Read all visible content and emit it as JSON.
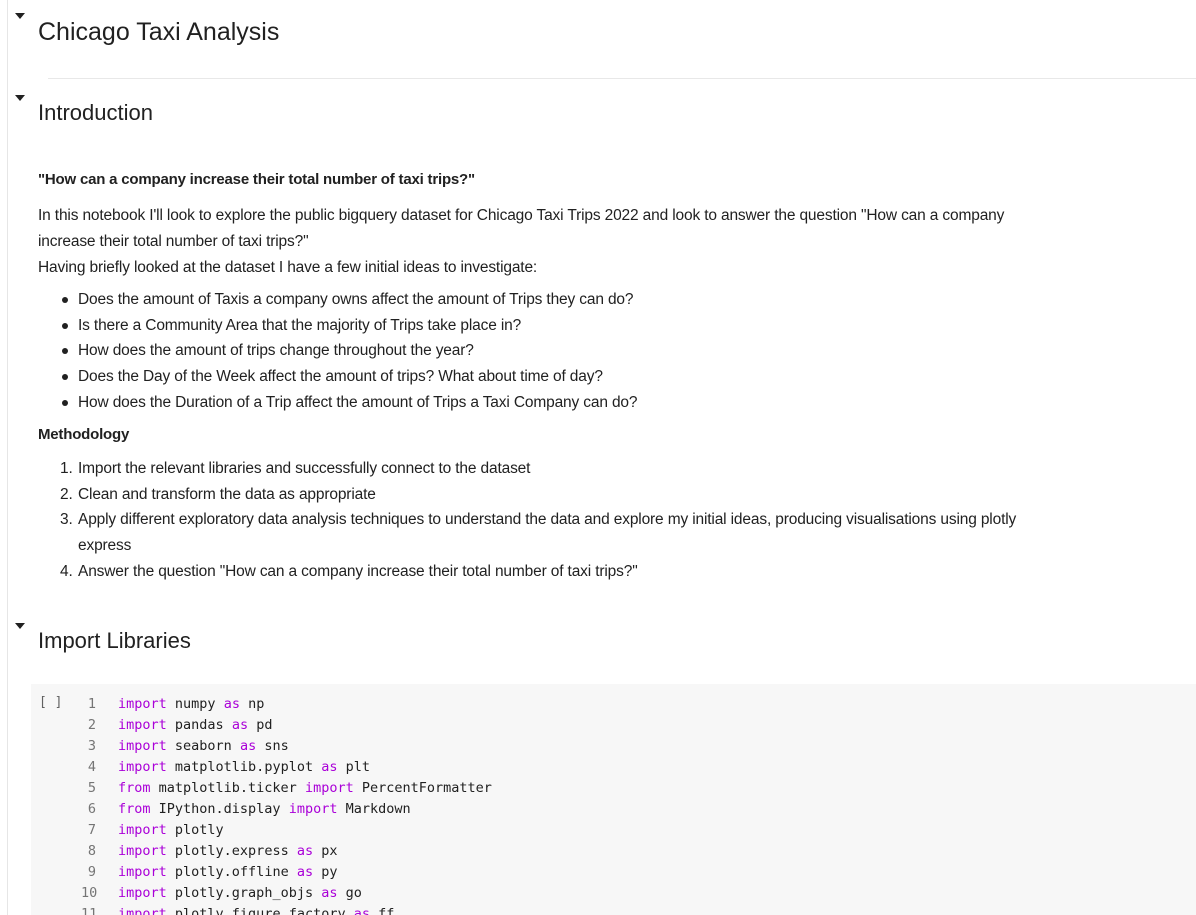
{
  "title": "Chicago Taxi Analysis",
  "intro": {
    "heading": "Introduction",
    "question": "\"How can a company increase their total number of taxi trips?\"",
    "paragraph_lines": [
      "In this notebook I'll look to explore the public bigquery dataset for Chicago Taxi Trips 2022 and look to answer the question \"How can a company increase their total number of taxi trips?\"",
      "Having briefly looked at the dataset I have a few initial ideas to investigate:"
    ],
    "bullets": [
      "Does the amount of Taxis a company owns affect the amount of Trips they can do?",
      "Is there a Community Area that the majority of Trips take place in?",
      "How does the amount of trips change throughout the year?",
      "Does the Day of the Week affect the amount of trips? What about time of day?",
      "How does the Duration of a Trip affect the amount of Trips a Taxi Company can do?"
    ],
    "methodology_heading": "Methodology",
    "steps": [
      {
        "num": "1.",
        "text": "Import the relevant libraries and successfully connect to the dataset"
      },
      {
        "num": "2.",
        "text": "Clean and transform the data as appropriate"
      },
      {
        "num": "3.",
        "text": "Apply different exploratory data analysis techniques to understand the data and explore my initial ideas, producing visualisations using plotly express"
      },
      {
        "num": "4.",
        "text": "Answer the question \"How can a company increase their total number of taxi trips?\""
      }
    ]
  },
  "imports": {
    "heading": "Import Libraries",
    "run_label": "[ ]",
    "lines": [
      {
        "n": "1",
        "parts": [
          [
            "kw",
            "import"
          ],
          [
            "tx",
            " numpy "
          ],
          [
            "kw",
            "as"
          ],
          [
            "tx",
            " np"
          ]
        ]
      },
      {
        "n": "2",
        "parts": [
          [
            "kw",
            "import"
          ],
          [
            "tx",
            " pandas "
          ],
          [
            "kw",
            "as"
          ],
          [
            "tx",
            " pd"
          ]
        ]
      },
      {
        "n": "3",
        "parts": [
          [
            "kw",
            "import"
          ],
          [
            "tx",
            " seaborn "
          ],
          [
            "kw",
            "as"
          ],
          [
            "tx",
            " sns"
          ]
        ]
      },
      {
        "n": "4",
        "parts": [
          [
            "kw",
            "import"
          ],
          [
            "tx",
            " matplotlib.pyplot "
          ],
          [
            "kw",
            "as"
          ],
          [
            "tx",
            " plt"
          ]
        ]
      },
      {
        "n": "5",
        "parts": [
          [
            "kw",
            "from"
          ],
          [
            "tx",
            " matplotlib.ticker "
          ],
          [
            "kw",
            "import"
          ],
          [
            "tx",
            " PercentFormatter"
          ]
        ]
      },
      {
        "n": "6",
        "parts": [
          [
            "kw",
            "from"
          ],
          [
            "tx",
            " IPython.display "
          ],
          [
            "kw",
            "import"
          ],
          [
            "tx",
            " Markdown"
          ]
        ]
      },
      {
        "n": "7",
        "parts": [
          [
            "kw",
            "import"
          ],
          [
            "tx",
            " plotly"
          ]
        ]
      },
      {
        "n": "8",
        "parts": [
          [
            "kw",
            "import"
          ],
          [
            "tx",
            " plotly.express "
          ],
          [
            "kw",
            "as"
          ],
          [
            "tx",
            " px"
          ]
        ]
      },
      {
        "n": "9",
        "parts": [
          [
            "kw",
            "import"
          ],
          [
            "tx",
            " plotly.offline "
          ],
          [
            "kw",
            "as"
          ],
          [
            "tx",
            " py"
          ]
        ]
      },
      {
        "n": "10",
        "parts": [
          [
            "kw",
            "import"
          ],
          [
            "tx",
            " plotly.graph_objs "
          ],
          [
            "kw",
            "as"
          ],
          [
            "tx",
            " go"
          ]
        ]
      },
      {
        "n": "11",
        "parts": [
          [
            "kw",
            "import"
          ],
          [
            "tx",
            " plotly.figure_factory "
          ],
          [
            "kw",
            "as"
          ],
          [
            "tx",
            " ff"
          ]
        ]
      }
    ]
  }
}
